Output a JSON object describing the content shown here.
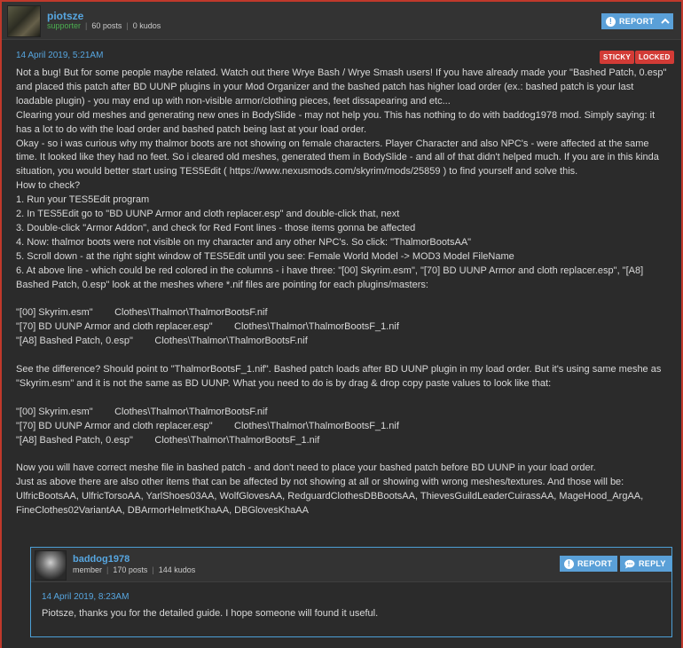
{
  "post": {
    "username": "piotsze",
    "role": "supporter",
    "posts": "60 posts",
    "kudos": "0 kudos",
    "report_label": "REPORT",
    "date": "14 April 2019, 5:21AM",
    "tags": {
      "sticky": "STICKY",
      "locked": "LOCKED"
    },
    "lines": [
      "Not a bug! But for some people maybe related. Watch out there Wrye Bash / Wrye Smash users! If you have already made your \"Bashed Patch, 0.esp\"",
      "and placed this patch after BD UUNP plugins in your Mod Organizer and the bashed patch has higher load order (ex.: bashed patch is your last",
      "loadable plugin) - you may end up with non-visible armor/clothing pieces, feet dissapearing and etc...",
      "Clearing your old meshes and generating new ones in BodySlide - may not help you. This has nothing to do with baddog1978 mod. Simply saying: it",
      "has a lot to do with the load order and bashed patch being last at your load order.",
      "Okay - so i was curious why my thalmor boots are not showing on female characters. Player Character and also NPC's - were affected at the same",
      "time. It looked like they had no feet. So i cleared old meshes, generated them in BodySlide - and all of that didn't helped much. If you are in this kinda",
      "situation, you would better start using TES5Edit ( https://www.nexusmods.com/skyrim/mods/25859 ) to find yourself and solve this.",
      "How to check?",
      "1. Run your TES5Edit program",
      "2. In TES5Edit go to \"BD UUNP Armor and cloth replacer.esp\" and double-click that, next",
      "3. Double-click \"Armor Addon\", and check for Red Font lines - those items gonna be affected",
      "4. Now: thalmor boots were not visible on my character and any other NPC's. So click: \"ThalmorBootsAA\"",
      "5. Scroll down - at the right sight window of TES5Edit until you see: Female World Model -> MOD3 Model FileName",
      "6. At above line - which could be red colored in the columns - i have three: \"[00] Skyrim.esm\", \"[70] BD UUNP Armor and cloth replacer.esp\", \"[A8]",
      "Bashed Patch, 0.esp\" look at the meshes where *.nif files are pointing for each plugins/masters:",
      "",
      "\"[00] Skyrim.esm\"        Clothes\\Thalmor\\ThalmorBootsF.nif",
      "\"[70] BD UUNP Armor and cloth replacer.esp\"        Clothes\\Thalmor\\ThalmorBootsF_1.nif",
      "\"[A8] Bashed Patch, 0.esp\"        Clothes\\Thalmor\\ThalmorBootsF.nif",
      "",
      "See the difference? Should point to \"ThalmorBootsF_1.nif\". Bashed patch loads after BD UUNP plugin in my load order. But it's using same meshe as",
      "\"Skyrim.esm\" and it is not the same as BD UUNP. What you need to do is by drag & drop copy paste values to look like that:",
      "",
      "\"[00] Skyrim.esm\"        Clothes\\Thalmor\\ThalmorBootsF.nif",
      "\"[70] BD UUNP Armor and cloth replacer.esp\"        Clothes\\Thalmor\\ThalmorBootsF_1.nif",
      "\"[A8] Bashed Patch, 0.esp\"        Clothes\\Thalmor\\ThalmorBootsF_1.nif",
      "",
      "Now you will have correct meshe file in bashed patch - and don't need to place your bashed patch before BD UUNP in your load order.",
      "Just as above there are also other items that can be affected by not showing at all or showing with wrong meshes/textures. And those will be:",
      "UlfricBootsAA, UlfricTorsoAA, YarlShoes03AA, WolfGlovesAA, RedguardClothesDBBootsAA, ThievesGuildLeaderCuirassAA, MageHood_ArgAA,",
      "FineClothes02VariantAA, DBArmorHelmetKhaAA, DBGlovesKhaAA"
    ]
  },
  "reply": {
    "username": "baddog1978",
    "role": "member",
    "posts": "170 posts",
    "kudos": "144 kudos",
    "report_label": "REPORT",
    "reply_label": "REPLY",
    "date": "14 April 2019, 8:23AM",
    "text": "Piotsze, thanks you for the detailed guide. I hope someone will found it useful."
  },
  "icons": {
    "report": "exclamation-icon",
    "collapse": "chevron-up-icon",
    "reply": "speech-bubble-icon"
  },
  "colors": {
    "accent": "#5aa0d8",
    "username": "#57a6e0",
    "supporter": "#4caf50",
    "tag": "#d23b36",
    "post_border": "#c0392b"
  }
}
